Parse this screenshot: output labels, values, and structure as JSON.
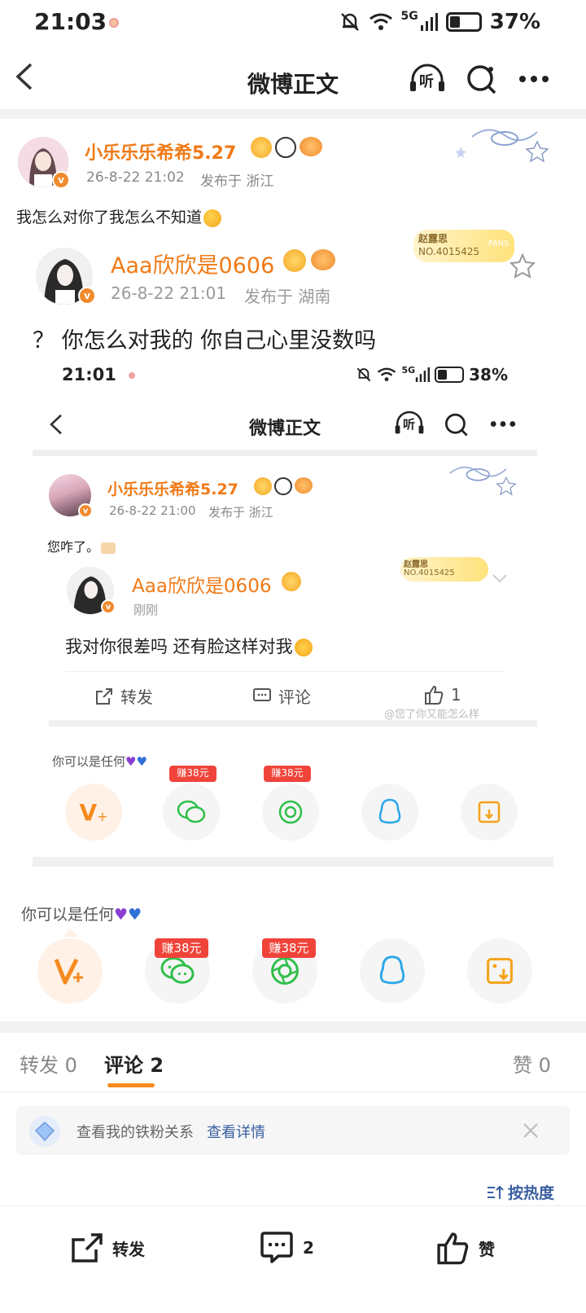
{
  "status_bar": {
    "time": "21:03",
    "signal": "5G",
    "battery": "37%",
    "battery_level": 0.37
  },
  "nav": {
    "title": "微博正文",
    "listen_label": "听"
  },
  "post": {
    "author": "小乐乐乐希希5.27",
    "time": "26-8-22 21:02",
    "location": "发布于 浙江",
    "text": "我怎么对你了我怎么不知道"
  },
  "repost": {
    "author": "Aaa欣欣是0606",
    "time": "26-8-22 21:01",
    "location": "发布于 湖南",
    "fans_name": "赵露思",
    "fans_no": "NO.4015425",
    "fans_tag": "FANS",
    "text": "？ 你怎么对我的 你自己心里没数吗"
  },
  "embedded": {
    "status_time": "21:01",
    "signal": "5G",
    "battery": "38%",
    "battery_level": 0.38,
    "nav_title": "微博正文",
    "listen_label": "听",
    "post": {
      "author": "小乐乐乐希希5.27",
      "time": "26-8-22 21:00",
      "location": "发布于 浙江",
      "text": "您咋了。"
    },
    "repost": {
      "author": "Aaa欣欣是0606",
      "time": "刚刚",
      "fans_name": "赵露思",
      "fans_no": "NO.4015425",
      "text": "我对你很差吗 还有脸这样对我"
    },
    "actions": {
      "repost": "转发",
      "comment": "评论",
      "like_count": "1"
    },
    "watermark": "@您了你又能怎么样",
    "share_title": "你可以是任何",
    "share_tags": [
      "赚38元",
      "赚38元"
    ]
  },
  "share": {
    "title": "你可以是任何",
    "tags": [
      "赚38元",
      "赚38元"
    ],
    "icons": [
      "vplus-icon",
      "wechat-icon",
      "moments-icon",
      "qq-icon",
      "save-image-icon"
    ]
  },
  "tabs": {
    "repost": "转发 0",
    "comment": "评论 2",
    "like": "赞 0"
  },
  "fans_notice": {
    "text": "查看我的铁粉关系",
    "link": "查看详情"
  },
  "sort": {
    "label": "按热度"
  },
  "bottom": {
    "repost": "转发",
    "comment": "2",
    "like": "赞"
  },
  "colors": {
    "accent": "#f07a16",
    "link": "#3a5fa0",
    "red_tag": "#f0443a",
    "vplus": "#f58a1f",
    "wechat": "#2fbf4a",
    "qq": "#2aa7e8"
  }
}
